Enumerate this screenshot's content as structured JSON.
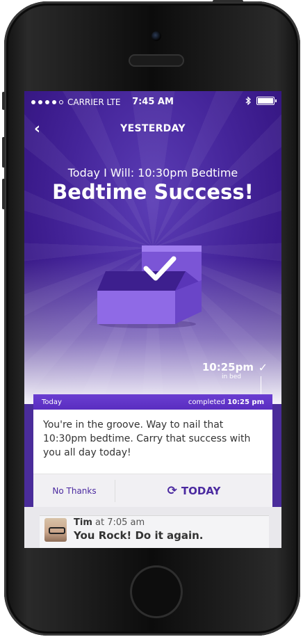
{
  "status_bar": {
    "carrier": "CARRIER LTE",
    "time": "7:45 AM"
  },
  "nav": {
    "back_icon": "‹",
    "title": "YESTERDAY"
  },
  "goal": {
    "today_will": "Today I Will: 10:30pm Bedtime",
    "headline": "Bedtime Success!"
  },
  "timeline": {
    "time": "10:25pm",
    "sublabel": "in bed",
    "day": "Today",
    "completed_prefix": "completed",
    "completed_time": "10:25 pm"
  },
  "card": {
    "message": "You're in the groove. Way to nail that 10:30pm bedtime. Carry that success with you all day today!"
  },
  "actions": {
    "no_thanks": "No Thanks",
    "repeat": "TODAY"
  },
  "comment": {
    "author": "Tim",
    "at": "at 7:05 am",
    "text": "You Rock!  Do it again."
  },
  "colors": {
    "accent": "#4b2aa0",
    "bar": "#5a2dc0"
  }
}
